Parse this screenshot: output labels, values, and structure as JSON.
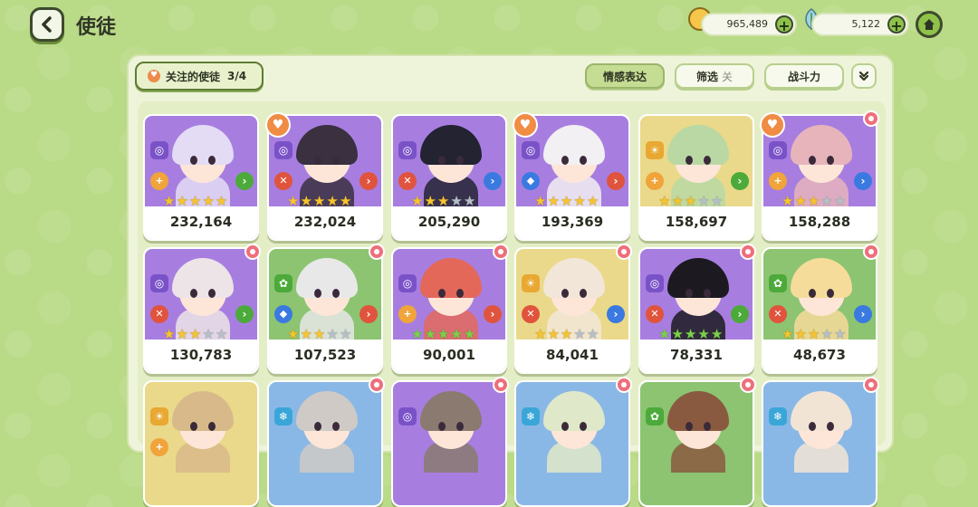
{
  "header": {
    "title": "使徒"
  },
  "currency": {
    "coins": "965,489",
    "leaves": "5,122",
    "plus": "+"
  },
  "toolbar": {
    "follow_label": "关注的使徒",
    "follow_count": "3/4",
    "emotion_label": "情感表达",
    "filter_label": "筛选",
    "filter_state": "关",
    "power_label": "战斗力"
  },
  "colors": {
    "purple": "#a77ee0",
    "yellow": "#ead98a",
    "green": "#8cc472",
    "blue": "#8ab8e6",
    "accent_orange": "#f08c44",
    "flower_pink": "#ee6f7a"
  },
  "cards": [
    {
      "power": "232,164",
      "bg": "purple",
      "stars": 5,
      "star_color": "gold",
      "favorite": false,
      "flower": false,
      "element": "spiral",
      "role": "plus",
      "arrow": "green",
      "hair": "#e3dcf4"
    },
    {
      "power": "232,024",
      "bg": "purple",
      "stars": 5,
      "star_color": "gold",
      "favorite": true,
      "flower": false,
      "element": "spiral",
      "role": "cross",
      "arrow": "red",
      "hair": "#3a3040"
    },
    {
      "power": "205,290",
      "bg": "purple",
      "stars": 3,
      "star_color": "gold",
      "favorite": false,
      "flower": false,
      "element": "spiral",
      "role": "cross",
      "arrow": "blue",
      "hair": "#232332"
    },
    {
      "power": "193,369",
      "bg": "purple",
      "stars": 5,
      "star_color": "gold",
      "favorite": true,
      "flower": false,
      "element": "spiral",
      "role": "shield",
      "arrow": "red",
      "hair": "#f2f0f2"
    },
    {
      "power": "158,697",
      "bg": "yellow",
      "stars": 3,
      "star_color": "gold",
      "favorite": false,
      "flower": false,
      "element": "sun",
      "role": "plus",
      "arrow": "green",
      "hair": "#b9d8a4"
    },
    {
      "power": "158,288",
      "bg": "purple",
      "stars": 3,
      "star_color": "gold",
      "favorite": true,
      "flower": true,
      "element": "spiral",
      "role": "plus",
      "arrow": "blue",
      "hair": "#e8b4bc"
    },
    {
      "power": "130,783",
      "bg": "purple",
      "stars": 3,
      "star_color": "gold",
      "favorite": false,
      "flower": true,
      "element": "spiral",
      "role": "cross",
      "arrow": "green",
      "hair": "#ece4e6"
    },
    {
      "power": "107,523",
      "bg": "green",
      "stars": 3,
      "star_color": "gold",
      "favorite": false,
      "flower": true,
      "element": "clover",
      "role": "shield",
      "arrow": "red",
      "hair": "#e8e8e8"
    },
    {
      "power": "90,001",
      "bg": "purple",
      "stars": 5,
      "star_color": "green",
      "favorite": false,
      "flower": true,
      "element": "spiral",
      "role": "plus",
      "arrow": "red",
      "hair": "#e4685a"
    },
    {
      "power": "84,041",
      "bg": "yellow",
      "stars": 3,
      "star_color": "gold",
      "favorite": false,
      "flower": true,
      "element": "sun",
      "role": "cross",
      "arrow": "blue",
      "hair": "#f2e6d8"
    },
    {
      "power": "78,331",
      "bg": "purple",
      "stars": 5,
      "star_color": "green",
      "favorite": false,
      "flower": true,
      "element": "spiral",
      "role": "cross",
      "arrow": "green",
      "hair": "#1c1a20"
    },
    {
      "power": "48,673",
      "bg": "green",
      "stars": 3,
      "star_color": "gold",
      "favorite": false,
      "flower": true,
      "element": "clover",
      "role": "cross",
      "arrow": "blue",
      "hair": "#f6dc9a"
    },
    {
      "power": "",
      "bg": "yellow",
      "stars": 0,
      "star_color": "gold",
      "favorite": false,
      "flower": false,
      "element": "sun",
      "role": "plus",
      "arrow": "",
      "hair": "#d8b98a"
    },
    {
      "power": "",
      "bg": "blue",
      "stars": 0,
      "star_color": "gold",
      "favorite": false,
      "flower": true,
      "element": "snow",
      "role": "",
      "arrow": "",
      "hair": "#cfcac6"
    },
    {
      "power": "",
      "bg": "purple",
      "stars": 0,
      "star_color": "gold",
      "favorite": false,
      "flower": true,
      "element": "spiral",
      "role": "",
      "arrow": "",
      "hair": "#8a7a70"
    },
    {
      "power": "",
      "bg": "blue",
      "stars": 0,
      "star_color": "gold",
      "favorite": false,
      "flower": true,
      "element": "snow",
      "role": "",
      "arrow": "",
      "hair": "#dfe8c8"
    },
    {
      "power": "",
      "bg": "green",
      "stars": 0,
      "star_color": "gold",
      "favorite": false,
      "flower": true,
      "element": "clover",
      "role": "",
      "arrow": "",
      "hair": "#8a5a40"
    },
    {
      "power": "",
      "bg": "blue",
      "stars": 0,
      "star_color": "gold",
      "favorite": false,
      "flower": true,
      "element": "snow",
      "role": "",
      "arrow": "",
      "hair": "#f2e4d4"
    }
  ]
}
